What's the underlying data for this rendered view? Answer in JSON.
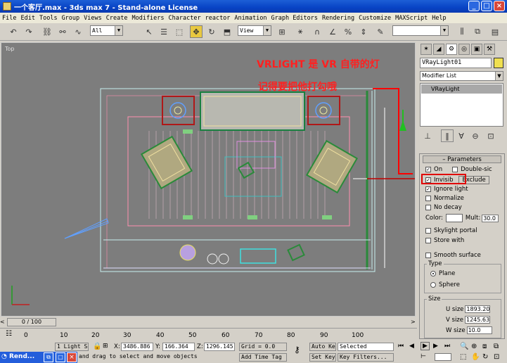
{
  "window": {
    "title": "一个客厅.max - 3ds max 7 - Stand-alone License"
  },
  "menu": [
    "File",
    "Edit",
    "Tools",
    "Group",
    "Views",
    "Create",
    "Modifiers",
    "Character",
    "reactor",
    "Animation",
    "Graph Editors",
    "Rendering",
    "Customize",
    "MAXScript",
    "Help"
  ],
  "toolbar": {
    "selection_filter": "All",
    "coord_system": "View"
  },
  "viewport": {
    "label": "Top",
    "annotation_line1": "VRLIGHT 是 VR 自带的灯",
    "annotation_line2": "记得要把他打勾哦"
  },
  "command_panel": {
    "object_name": "VRayLight01",
    "object_color": "#f0e050",
    "modifier_list_label": "Modifier List",
    "stack_item": "VRayLight",
    "rollout_title": "Parameters",
    "on_label": "On",
    "double_sided_label": "Double-sic",
    "invisible_label": "Invisib",
    "exclude_label": "Exclude",
    "ignore_light_label": "Ignore light",
    "normalize_label": "Normalize",
    "no_decay_label": "No decay",
    "color_label": "Color:",
    "mult_label": "Mult:",
    "mult_value": "30.0",
    "skylight_portal_label": "Skylight portal",
    "store_with_label": "Store with",
    "smooth_surface_label": "Smooth surface",
    "type_group_label": "Type",
    "type_plane_label": "Plane",
    "type_sphere_label": "Sphere",
    "size_group_label": "Size",
    "u_size_label": "U size",
    "u_size_value": "1893.20",
    "v_size_label": "V size",
    "v_size_value": "1245.63",
    "w_size_label": "W size",
    "w_size_value": "10.0"
  },
  "timeline": {
    "frame_display": "0 / 100",
    "ticks": [
      "0",
      "10",
      "20",
      "30",
      "40",
      "50",
      "60",
      "70",
      "80",
      "90",
      "100"
    ]
  },
  "status": {
    "selection_count": "1 Light Se",
    "x_label": "X:",
    "x_value": "3486.886",
    "y_label": "Y:",
    "y_value": "166.364",
    "z_label": "Z:",
    "z_value": "1296.145",
    "grid": "Grid = 0.0",
    "auto_key": "Auto Key",
    "set_key": "Set Key",
    "key_mode": "Selected",
    "key_filters": "Key Filters...",
    "prompt": "and drag to select and move objects",
    "add_time_tag": "Add Time Tag"
  },
  "taskbar": {
    "item": "Rend..."
  }
}
